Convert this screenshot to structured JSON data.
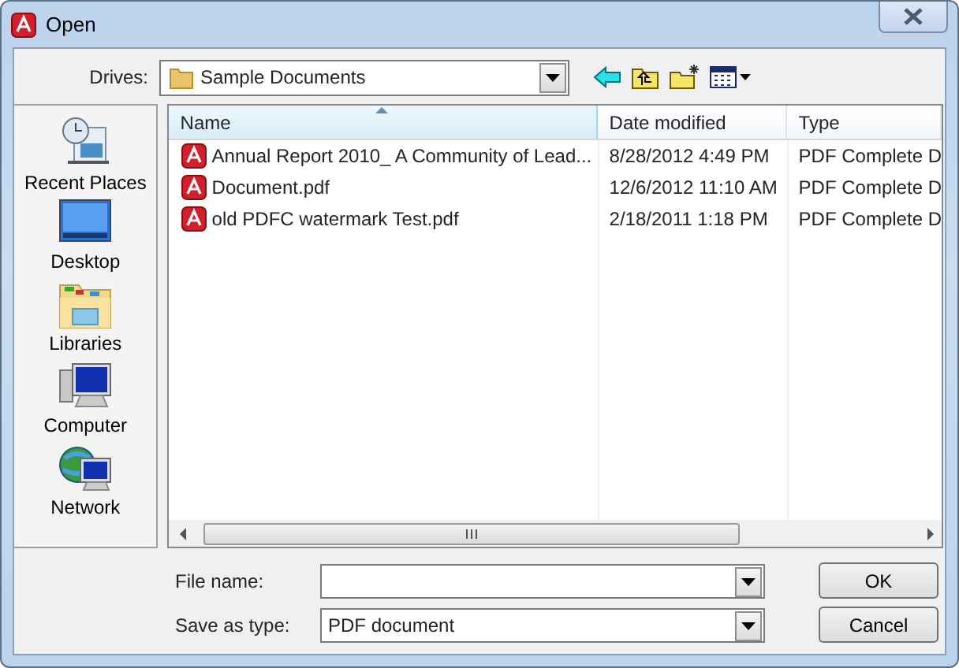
{
  "window": {
    "title": "Open"
  },
  "drives": {
    "label": "Drives:",
    "value": "Sample Documents"
  },
  "places": [
    {
      "kind": "recent",
      "label": "Recent Places"
    },
    {
      "kind": "desktop",
      "label": "Desktop"
    },
    {
      "kind": "libraries",
      "label": "Libraries"
    },
    {
      "kind": "computer",
      "label": "Computer"
    },
    {
      "kind": "network",
      "label": "Network"
    }
  ],
  "table": {
    "columns": [
      "Name",
      "Date modified",
      "Type"
    ],
    "rows": [
      {
        "name": "Annual Report 2010_ A Community of Lead...",
        "date": "8/28/2012 4:49 PM",
        "type": "PDF Complete D"
      },
      {
        "name": "Document.pdf",
        "date": "12/6/2012 11:10 AM",
        "type": "PDF Complete D"
      },
      {
        "name": "old PDFC watermark Test.pdf",
        "date": "2/18/2011 1:18 PM",
        "type": "PDF Complete D"
      }
    ]
  },
  "file_name": {
    "label": "File name:"
  },
  "save_as_type": {
    "label": "Save as type:",
    "value": "PDF document"
  },
  "buttons": [
    "OK",
    "Cancel"
  ]
}
